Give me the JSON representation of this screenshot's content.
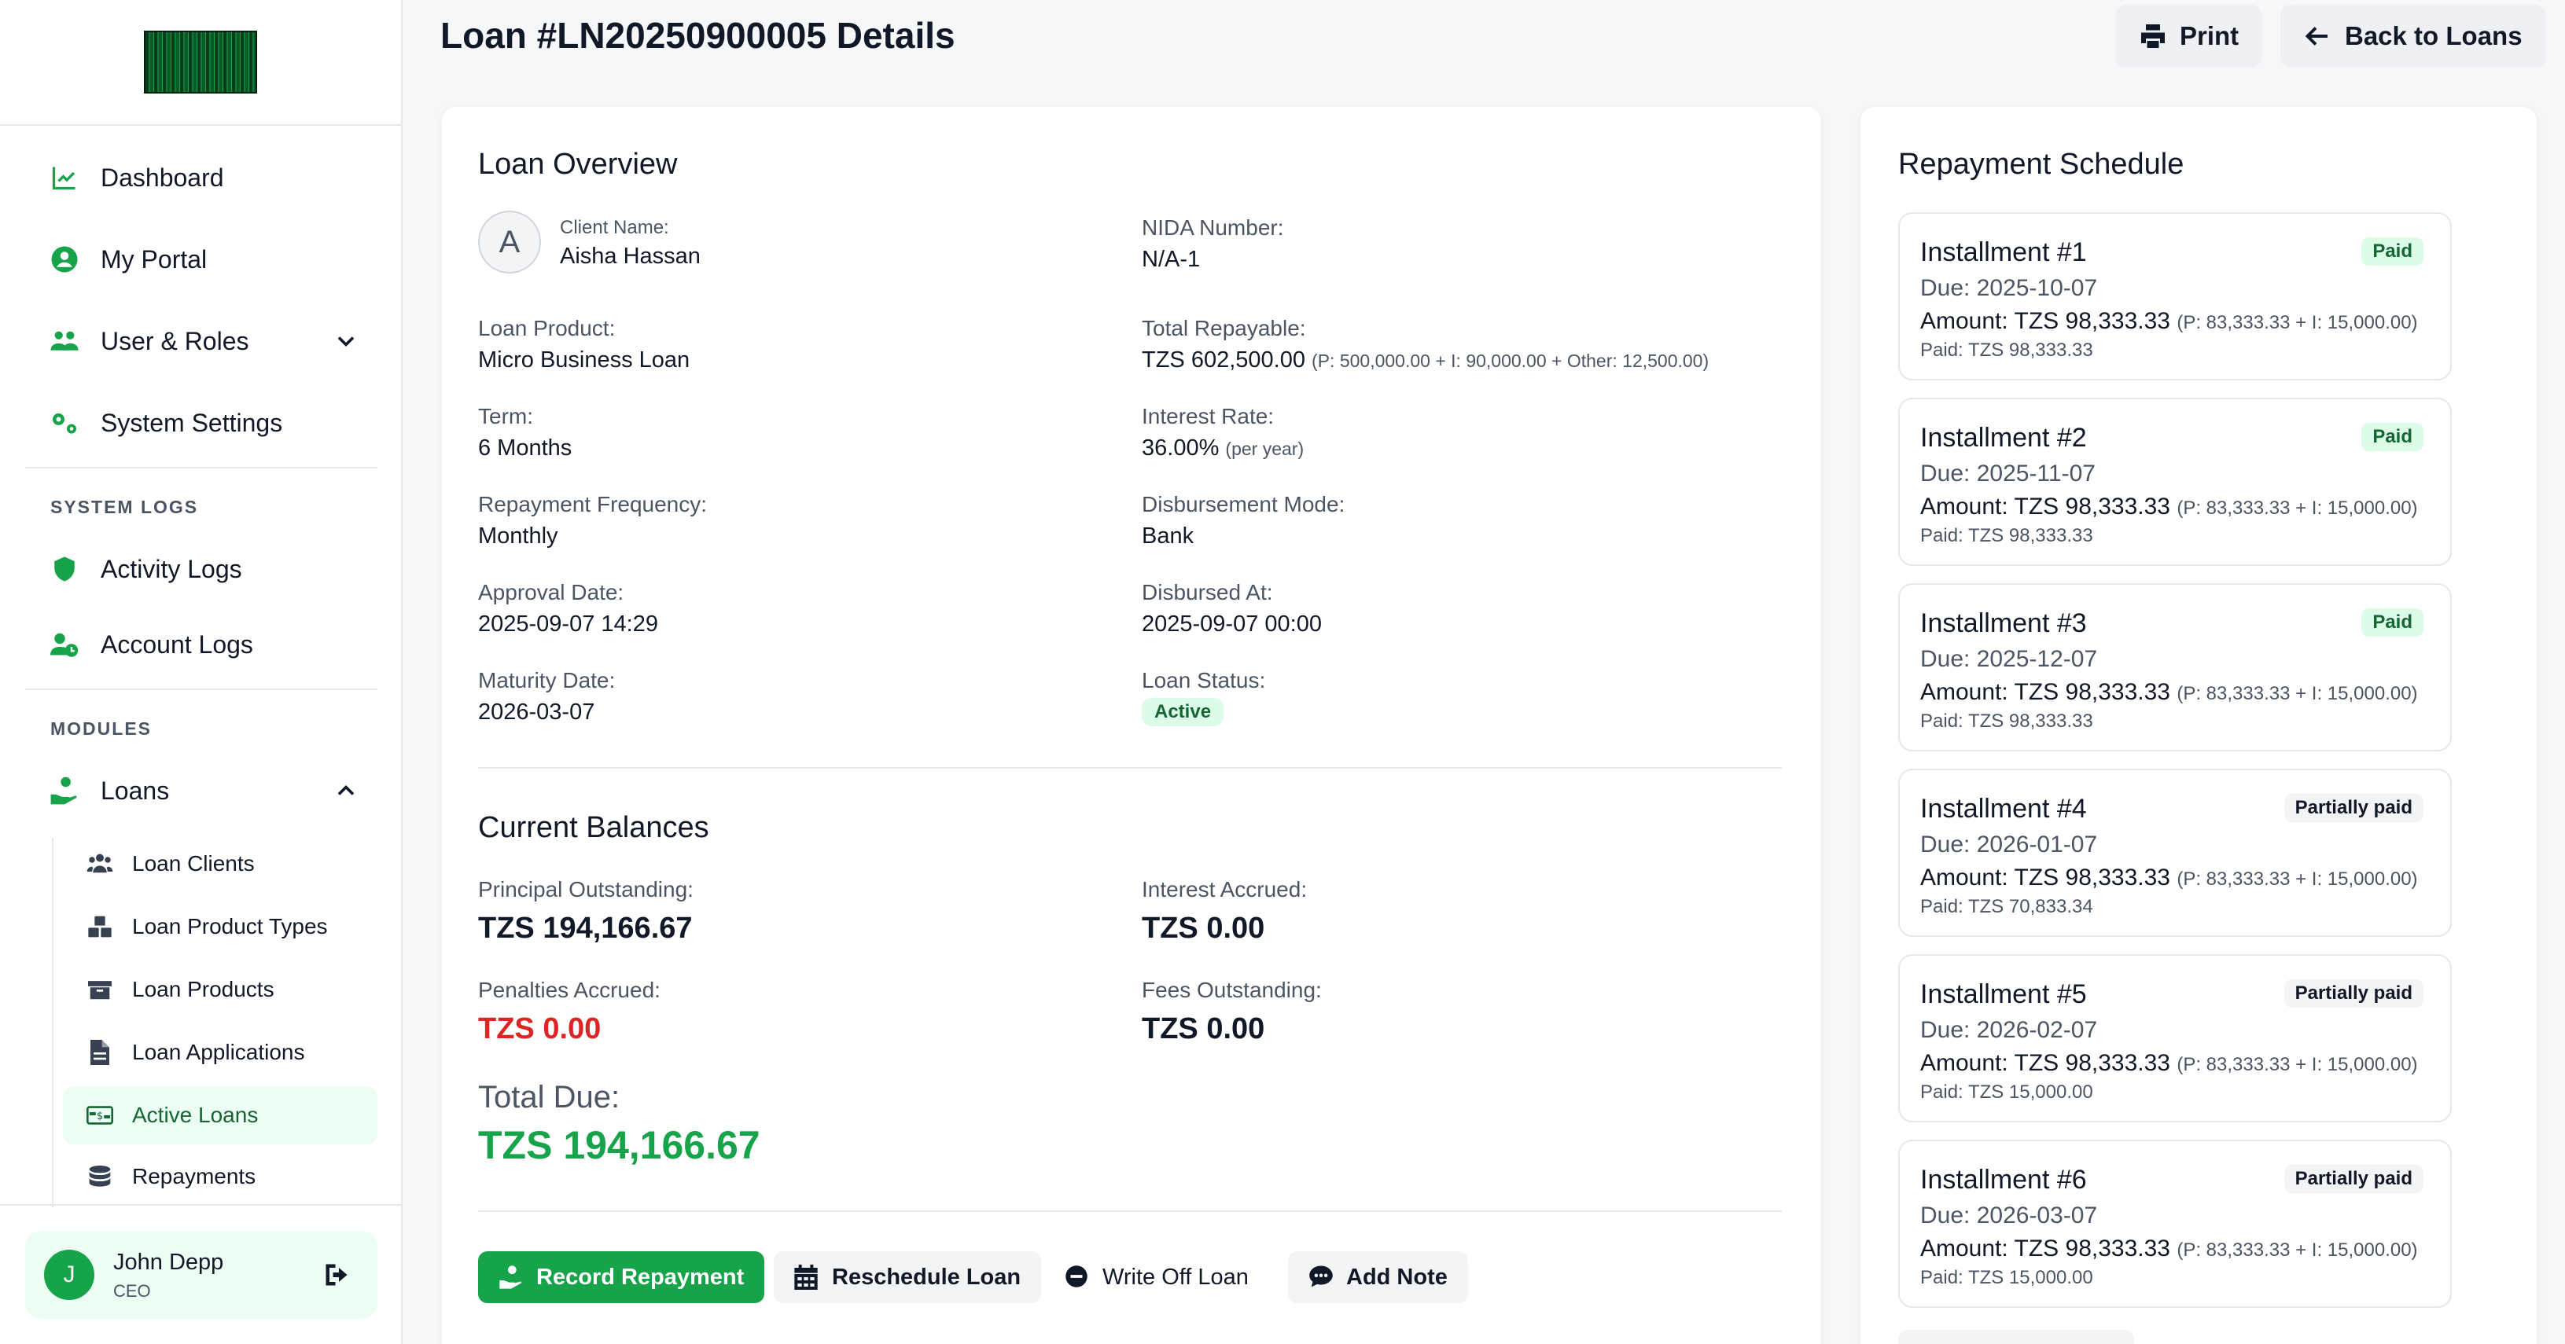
{
  "sidebar": {
    "nav": [
      {
        "label": "Dashboard",
        "icon": "chart-line-icon"
      },
      {
        "label": "My Portal",
        "icon": "user-circle-icon"
      },
      {
        "label": "User & Roles",
        "icon": "users-icon"
      },
      {
        "label": "System Settings",
        "icon": "gears-icon"
      }
    ],
    "section_logs": "SYSTEM LOGS",
    "logs": [
      {
        "label": "Activity Logs",
        "icon": "shield-icon"
      },
      {
        "label": "Account Logs",
        "icon": "user-clock-icon"
      }
    ],
    "section_modules": "MODULES",
    "loans_label": "Loans",
    "loan_items": [
      {
        "label": "Loan Clients",
        "icon": "users-icon"
      },
      {
        "label": "Loan Product Types",
        "icon": "boxes-icon"
      },
      {
        "label": "Loan Products",
        "icon": "box-icon"
      },
      {
        "label": "Loan Applications",
        "icon": "file-icon"
      },
      {
        "label": "Active Loans",
        "icon": "money-bill-icon"
      },
      {
        "label": "Repayments",
        "icon": "coins-icon"
      }
    ],
    "user": {
      "initial": "J",
      "name": "John Depp",
      "role": "CEO"
    }
  },
  "header": {
    "title": "Loan #LN20250900005 Details",
    "print_label": "Print",
    "back_label": "Back to Loans"
  },
  "overview": {
    "title": "Loan Overview",
    "client_initial": "A",
    "client_name_label": "Client Name:",
    "client_name": "Aisha Hassan",
    "nida_label": "NIDA Number:",
    "nida": "N/A-1",
    "product_label": "Loan Product:",
    "product": "Micro Business Loan",
    "total_repayable_label": "Total Repayable:",
    "total_repayable": "TZS 602,500.00",
    "total_repayable_breakdown": "(P: 500,000.00 + I: 90,000.00 + Other: 12,500.00)",
    "term_label": "Term:",
    "term": "6 Months",
    "interest_rate_label": "Interest Rate:",
    "interest_rate": "36.00%",
    "interest_rate_note": "(per year)",
    "frequency_label": "Repayment Frequency:",
    "frequency": "Monthly",
    "disbursement_mode_label": "Disbursement Mode:",
    "disbursement_mode": "Bank",
    "approval_label": "Approval Date:",
    "approval": "2025-09-07 14:29",
    "disbursed_label": "Disbursed At:",
    "disbursed": "2025-09-07 00:00",
    "maturity_label": "Maturity Date:",
    "maturity": "2026-03-07",
    "status_label": "Loan Status:",
    "status": "Active"
  },
  "balances": {
    "title": "Current Balances",
    "principal_label": "Principal Outstanding:",
    "principal": "TZS 194,166.67",
    "interest_label": "Interest Accrued:",
    "interest": "TZS 0.00",
    "penalties_label": "Penalties Accrued:",
    "penalties": "TZS 0.00",
    "fees_label": "Fees Outstanding:",
    "fees": "TZS 0.00",
    "total_due_label": "Total Due:",
    "total_due": "TZS 194,166.67"
  },
  "actions": {
    "record": "Record Repayment",
    "reschedule": "Reschedule Loan",
    "writeoff": "Write Off Loan",
    "note": "Add Note"
  },
  "schedule": {
    "title": "Repayment Schedule",
    "installments": [
      {
        "title": "Installment #1",
        "badge": "Paid",
        "due": "Due: 2025-10-07",
        "amount": "Amount: TZS 98,333.33",
        "breakdown": "(P: 83,333.33 + I: 15,000.00)",
        "paid": "Paid: TZS 98,333.33"
      },
      {
        "title": "Installment #2",
        "badge": "Paid",
        "due": "Due: 2025-11-07",
        "amount": "Amount: TZS 98,333.33",
        "breakdown": "(P: 83,333.33 + I: 15,000.00)",
        "paid": "Paid: TZS 98,333.33"
      },
      {
        "title": "Installment #3",
        "badge": "Paid",
        "due": "Due: 2025-12-07",
        "amount": "Amount: TZS 98,333.33",
        "breakdown": "(P: 83,333.33 + I: 15,000.00)",
        "paid": "Paid: TZS 98,333.33"
      },
      {
        "title": "Installment #4",
        "badge": "Partially paid",
        "due": "Due: 2026-01-07",
        "amount": "Amount: TZS 98,333.33",
        "breakdown": "(P: 83,333.33 + I: 15,000.00)",
        "paid": "Paid: TZS 70,833.34"
      },
      {
        "title": "Installment #5",
        "badge": "Partially paid",
        "due": "Due: 2026-02-07",
        "amount": "Amount: TZS 98,333.33",
        "breakdown": "(P: 83,333.33 + I: 15,000.00)",
        "paid": "Paid: TZS 15,000.00"
      },
      {
        "title": "Installment #6",
        "badge": "Partially paid",
        "due": "Due: 2026-03-07",
        "amount": "Amount: TZS 98,333.33",
        "breakdown": "(P: 83,333.33 + I: 15,000.00)",
        "paid": "Paid: TZS 15,000.00"
      }
    ]
  },
  "colors": {
    "accent": "#16a34a",
    "danger": "#dc2626",
    "active_bg": "#ecfdf3"
  }
}
